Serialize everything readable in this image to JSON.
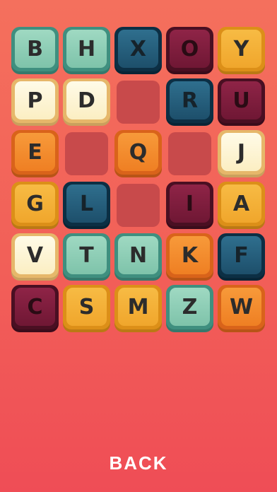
{
  "board": {
    "rows": [
      [
        {
          "letter": "B",
          "color": "teal"
        },
        {
          "letter": "H",
          "color": "teal"
        },
        {
          "letter": "X",
          "color": "navy"
        },
        {
          "letter": "O",
          "color": "maroon"
        },
        {
          "letter": "Y",
          "color": "yellow"
        }
      ],
      [
        {
          "letter": "P",
          "color": "cream"
        },
        {
          "letter": "D",
          "color": "cream"
        },
        {
          "letter": "",
          "color": "empty"
        },
        {
          "letter": "R",
          "color": "navy"
        },
        {
          "letter": "U",
          "color": "maroon"
        }
      ],
      [
        {
          "letter": "E",
          "color": "orange"
        },
        {
          "letter": "",
          "color": "empty"
        },
        {
          "letter": "Q",
          "color": "orange"
        },
        {
          "letter": "",
          "color": "empty"
        },
        {
          "letter": "J",
          "color": "cream"
        }
      ],
      [
        {
          "letter": "G",
          "color": "yellow"
        },
        {
          "letter": "L",
          "color": "navy"
        },
        {
          "letter": "",
          "color": "empty"
        },
        {
          "letter": "I",
          "color": "maroon"
        },
        {
          "letter": "A",
          "color": "yellow"
        }
      ],
      [
        {
          "letter": "V",
          "color": "cream"
        },
        {
          "letter": "T",
          "color": "teal"
        },
        {
          "letter": "N",
          "color": "teal"
        },
        {
          "letter": "K",
          "color": "orange"
        },
        {
          "letter": "F",
          "color": "navy"
        }
      ],
      [
        {
          "letter": "C",
          "color": "maroon"
        },
        {
          "letter": "S",
          "color": "yellow"
        },
        {
          "letter": "M",
          "color": "yellow"
        },
        {
          "letter": "Z",
          "color": "teal"
        },
        {
          "letter": "W",
          "color": "orange"
        }
      ]
    ]
  },
  "back_label": "BACK"
}
